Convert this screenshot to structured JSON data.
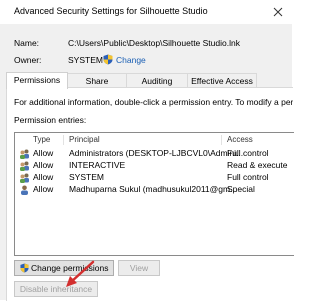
{
  "window": {
    "title": "Advanced Security Settings for Silhouette Studio"
  },
  "header": {
    "name_label": "Name:",
    "name_value": "C:\\Users\\Public\\Desktop\\Silhouette Studio.lnk",
    "owner_label": "Owner:",
    "owner_value": "SYSTEM",
    "change_link": "Change"
  },
  "tabs": [
    {
      "label": "Permissions",
      "active": true
    },
    {
      "label": "Share",
      "active": false
    },
    {
      "label": "Auditing",
      "active": false
    },
    {
      "label": "Effective Access",
      "active": false
    }
  ],
  "panel": {
    "info_text": "For additional information, double-click a permission entry. To modify a permission",
    "entries_label": "Permission entries:"
  },
  "table": {
    "columns": [
      "Type",
      "Principal",
      "Access"
    ],
    "rows": [
      {
        "type": "Allow",
        "principal": "Administrators (DESKTOP-LJBCVL0\\Admini...",
        "access": "Full control"
      },
      {
        "type": "Allow",
        "principal": "INTERACTIVE",
        "access": "Read & execute"
      },
      {
        "type": "Allow",
        "principal": "SYSTEM",
        "access": "Full control"
      },
      {
        "type": "Allow",
        "principal": "Madhuparna Sukul (madhusukul2011@gm...",
        "access": "Special"
      }
    ]
  },
  "buttons": {
    "change_permissions": "Change permissions",
    "view": "View",
    "disable_inheritance": "Disable inheritance"
  },
  "colors": {
    "accent": "#1a5fb4",
    "arrow": "#d32f2f",
    "dialog_bg": "#f0f0f0"
  }
}
